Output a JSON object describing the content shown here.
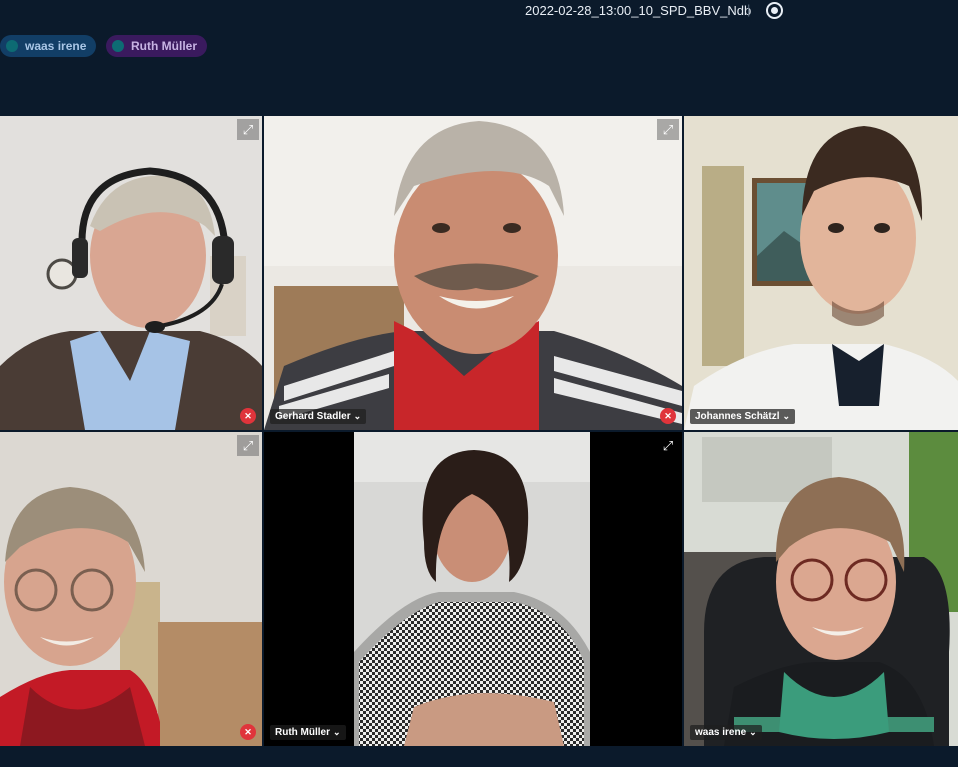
{
  "header": {
    "recording_title": "2022-02-28_13:00_10_SPD_BBV_Ndb",
    "divider": "|",
    "record_icon": "record-icon"
  },
  "speaker_chips": [
    {
      "label": "waas irene",
      "dot_color": "#0d6b73"
    },
    {
      "label": "Ruth Müller",
      "dot_color": "#0d6b73"
    }
  ],
  "tiles": [
    {
      "name": "",
      "expand_icon": "expand-icon",
      "muted": true
    },
    {
      "name": "Gerhard Stadler",
      "expand_icon": "expand-icon",
      "muted": true
    },
    {
      "name": "Johannes Schätzl",
      "muted": false
    },
    {
      "name": "",
      "expand_icon": "expand-icon",
      "muted": true
    },
    {
      "name": "Ruth Müller",
      "expand_icon": "expand-icon",
      "muted": false
    },
    {
      "name": "waas irene",
      "muted": false
    }
  ],
  "glyphs": {
    "chevron": "⌄",
    "expand": "⤢",
    "mic_off": "✕"
  },
  "colors": {
    "background": "#0b1a2b",
    "mute_badge": "#e0343b",
    "chip_waas": "#123e66",
    "chip_ruth": "#3a1a5e"
  }
}
